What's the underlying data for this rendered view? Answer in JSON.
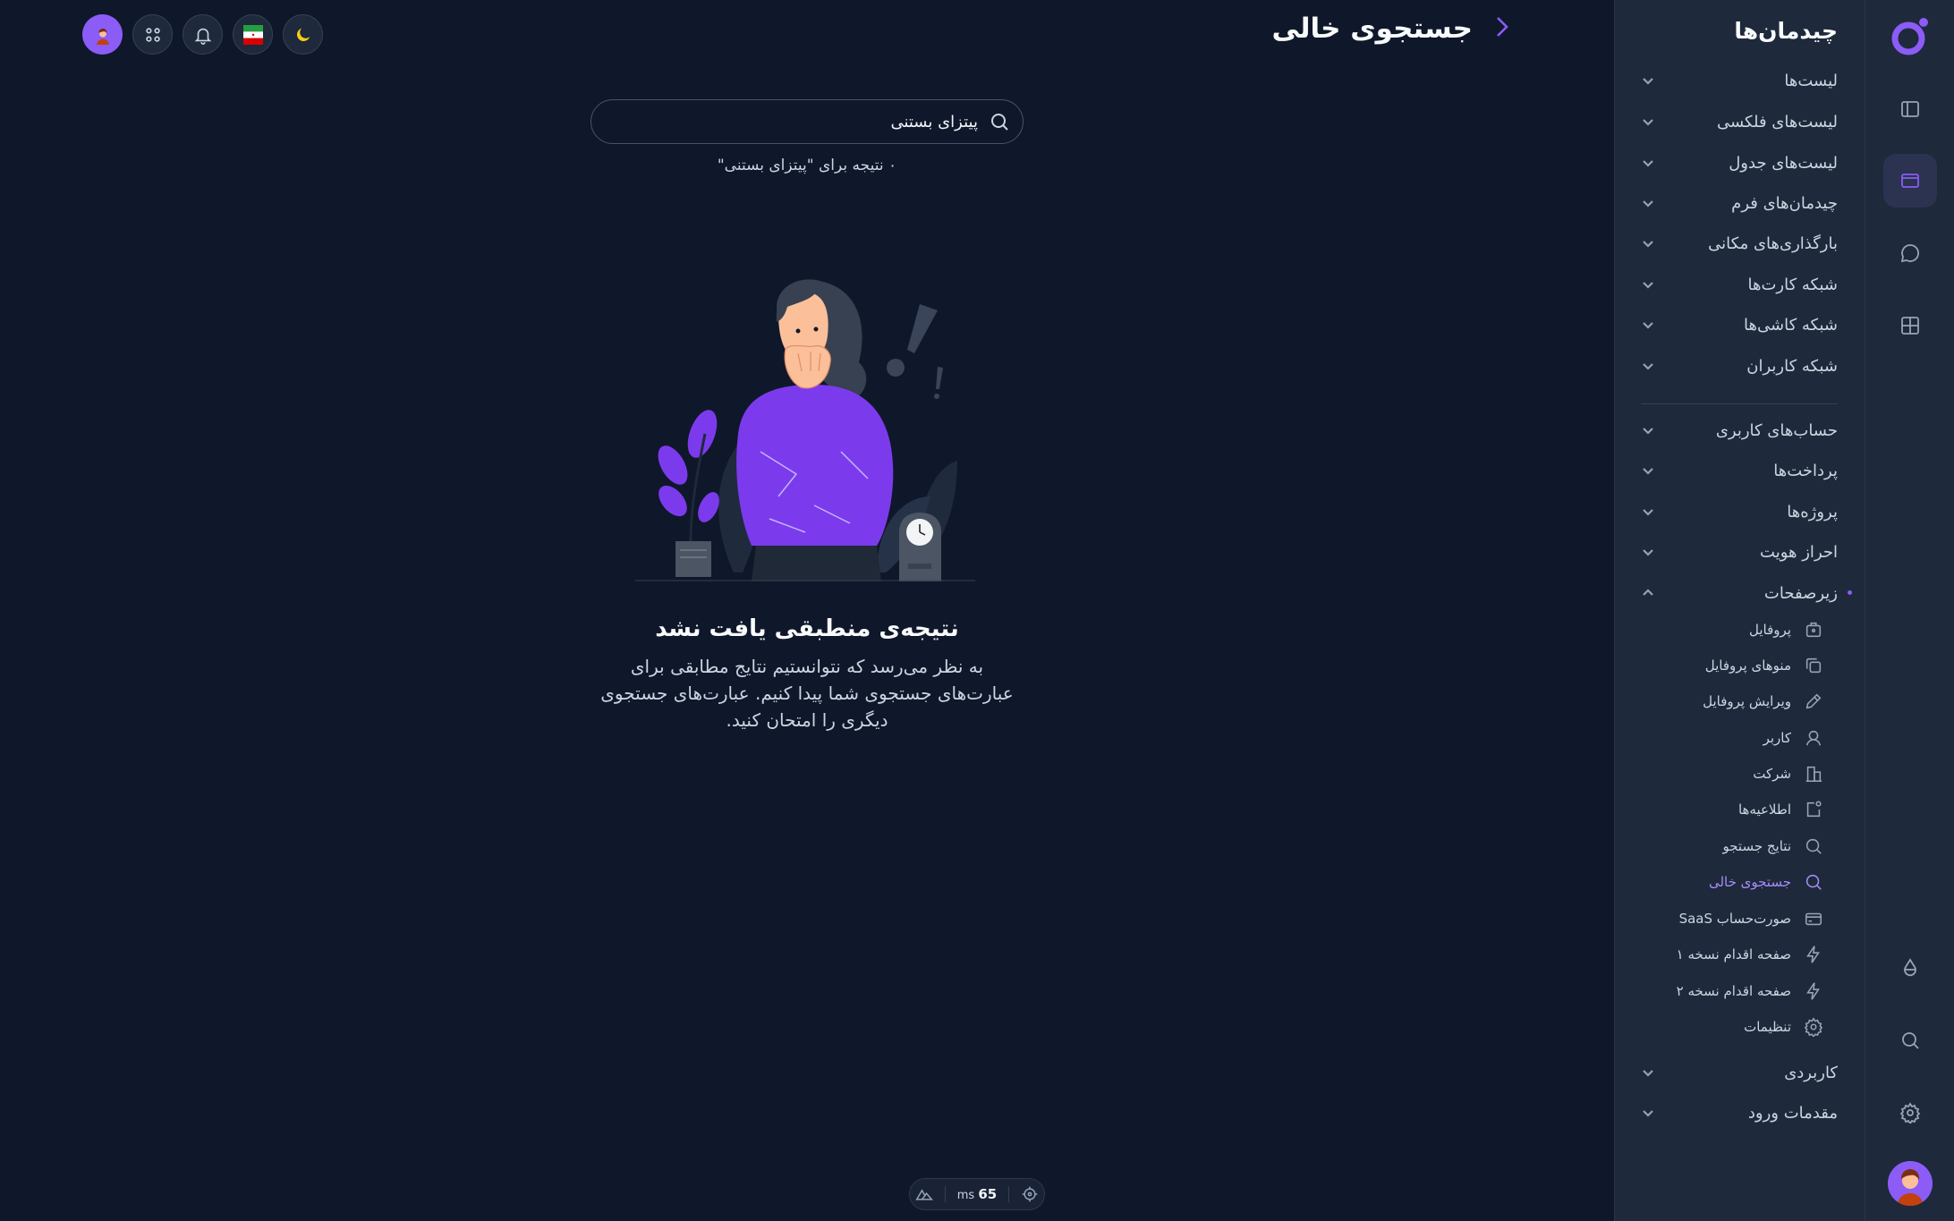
{
  "header": {
    "title": "جستجوی خالی"
  },
  "search": {
    "value": "پیتزای بستنی",
    "result_count": "۰ نتیجه برای \"پیتزای بستنی\""
  },
  "empty_state": {
    "title": "نتیجه‌ی منطبقی یافت نشد",
    "message": "به نظر می‌رسد که نتوانستیم نتایج مطابقی برای عبارت‌های جستجوی شما پیدا کنیم. عبارت‌های جستجوی دیگری را امتحان کنید."
  },
  "menu": {
    "title": "چیدمان‌ها",
    "groups_top": [
      "لیست‌ها",
      "لیست‌های فلکسی",
      "لیست‌های جدول",
      "چیدمان‌های فرم",
      "بارگذاری‌های مکانی",
      "شبکه کارت‌ها",
      "شبکه کاشی‌ها",
      "شبکه کاربران"
    ],
    "groups_bottom": [
      "حساب‌های کاربری",
      "پرداخت‌ها",
      "پروژه‌ها",
      "احراز هویت",
      "زیرصفحات"
    ],
    "subitems": [
      "پروفایل",
      "منوهای پروفایل",
      "ویرایش پروفایل",
      "کاربر",
      "شرکت",
      "اطلاعیه‌ها",
      "نتایج جستجو",
      "جستجوی خالی",
      "صورت‌حساب SaaS",
      "صفحه اقدام نسخه ۱",
      "صفحه اقدام نسخه ۲",
      "تنظیمات"
    ],
    "groups_tail": [
      "کاربردی",
      "مقدمات ورود"
    ]
  },
  "devbar": {
    "ms_value": "65",
    "ms_unit": "ms"
  },
  "colors": {
    "background": "#0f172a",
    "panel": "#1e293b",
    "accent": "#8b5cf6",
    "illustration_purple": "#7c3aed"
  }
}
